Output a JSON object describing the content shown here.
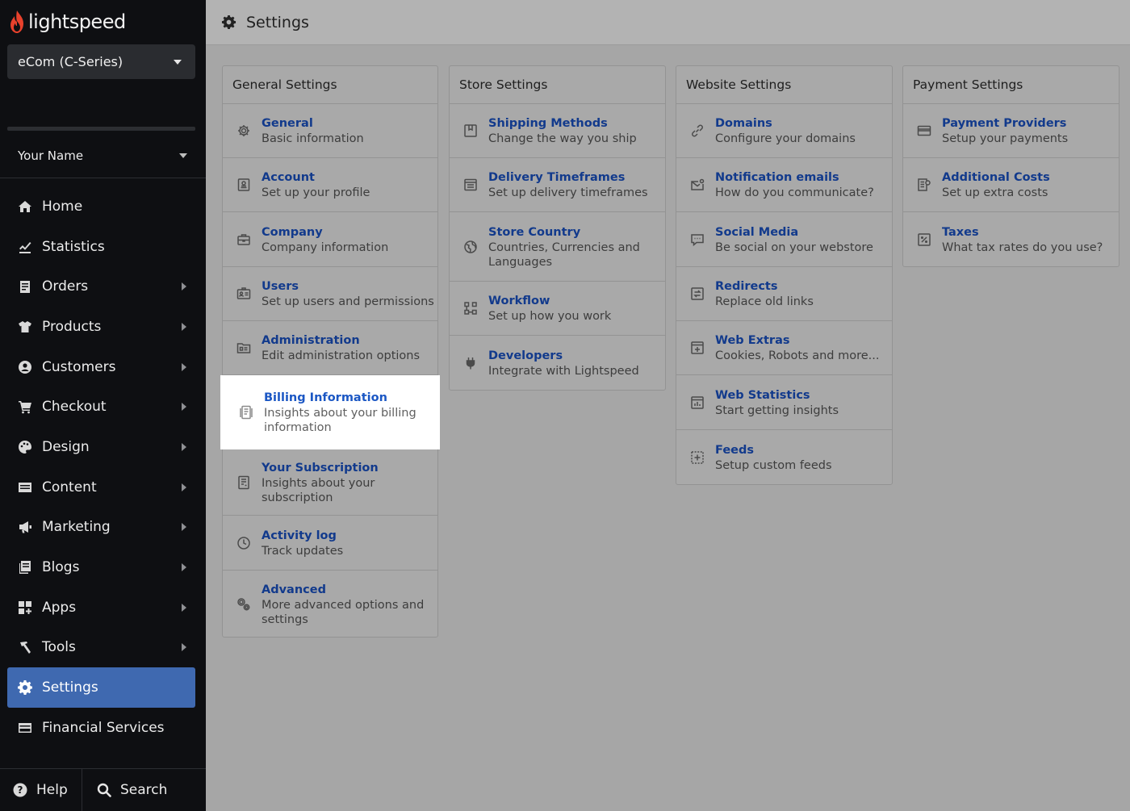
{
  "brand": {
    "name": "lightspeed"
  },
  "store_selector": {
    "value": "eCom (C-Series)"
  },
  "user": {
    "name": "Your Name"
  },
  "nav": [
    {
      "label": "Home",
      "icon": "home-icon"
    },
    {
      "label": "Statistics",
      "icon": "statistics-icon"
    },
    {
      "label": "Orders",
      "icon": "orders-icon"
    },
    {
      "label": "Products",
      "icon": "products-icon"
    },
    {
      "label": "Customers",
      "icon": "customers-icon"
    },
    {
      "label": "Checkout",
      "icon": "cart-icon"
    },
    {
      "label": "Design",
      "icon": "palette-icon"
    },
    {
      "label": "Content",
      "icon": "content-icon"
    },
    {
      "label": "Marketing",
      "icon": "megaphone-icon"
    },
    {
      "label": "Blogs",
      "icon": "blogs-icon"
    },
    {
      "label": "Apps",
      "icon": "apps-icon"
    },
    {
      "label": "Tools",
      "icon": "hammer-icon"
    },
    {
      "label": "Settings",
      "icon": "gear-icon",
      "active": true
    },
    {
      "label": "Financial Services",
      "icon": "card-icon"
    }
  ],
  "footer": {
    "help": "Help",
    "search": "Search"
  },
  "page": {
    "title": "Settings"
  },
  "sections": {
    "general": {
      "title": "General Settings",
      "items": [
        {
          "title": "General",
          "desc": "Basic information",
          "icon": "gear-icon"
        },
        {
          "title": "Account",
          "desc": "Set up your profile",
          "icon": "account-icon"
        },
        {
          "title": "Company",
          "desc": "Company information",
          "icon": "briefcase-icon"
        },
        {
          "title": "Users",
          "desc": "Set up users and permissions",
          "icon": "users-icon"
        },
        {
          "title": "Administration",
          "desc": "Edit administration options",
          "icon": "folder-icon"
        },
        {
          "title": "Billing Information",
          "desc": "Insights about your billing information",
          "icon": "billing-icon"
        },
        {
          "title": "Your Subscription",
          "desc": "Insights about your subscription",
          "icon": "subscription-icon"
        },
        {
          "title": "Activity log",
          "desc": "Track updates",
          "icon": "clock-icon"
        },
        {
          "title": "Advanced",
          "desc": "More advanced options and settings",
          "icon": "gears-icon"
        }
      ]
    },
    "store": {
      "title": "Store Settings",
      "items": [
        {
          "title": "Shipping Methods",
          "desc": "Change the way you ship",
          "icon": "box-icon"
        },
        {
          "title": "Delivery Timeframes",
          "desc": "Set up delivery timeframes",
          "icon": "calendar-icon"
        },
        {
          "title": "Store Country",
          "desc": "Countries, Currencies and Languages",
          "icon": "globe-icon"
        },
        {
          "title": "Workflow",
          "desc": "Set up how you work",
          "icon": "workflow-icon"
        },
        {
          "title": "Developers",
          "desc": "Integrate with Lightspeed",
          "icon": "plug-icon"
        }
      ]
    },
    "website": {
      "title": "Website Settings",
      "items": [
        {
          "title": "Domains",
          "desc": "Configure your domains",
          "icon": "link-icon"
        },
        {
          "title": "Notification emails",
          "desc": "How do you communicate?",
          "icon": "email-icon"
        },
        {
          "title": "Social Media",
          "desc": "Be social on your webstore",
          "icon": "chat-icon"
        },
        {
          "title": "Redirects",
          "desc": "Replace old links",
          "icon": "redirect-icon"
        },
        {
          "title": "Web Extras",
          "desc": "Cookies, Robots and more...",
          "icon": "window-plus-icon"
        },
        {
          "title": "Web Statistics",
          "desc": "Start getting insights",
          "icon": "chart-icon"
        },
        {
          "title": "Feeds",
          "desc": "Setup custom feeds",
          "icon": "feeds-icon"
        }
      ]
    },
    "payment": {
      "title": "Payment Settings",
      "items": [
        {
          "title": "Payment Providers",
          "desc": "Setup your payments",
          "icon": "credit-card-icon"
        },
        {
          "title": "Additional Costs",
          "desc": "Set up extra costs",
          "icon": "costs-icon"
        },
        {
          "title": "Taxes",
          "desc": "What tax rates do you use?",
          "icon": "percent-icon"
        }
      ]
    }
  }
}
